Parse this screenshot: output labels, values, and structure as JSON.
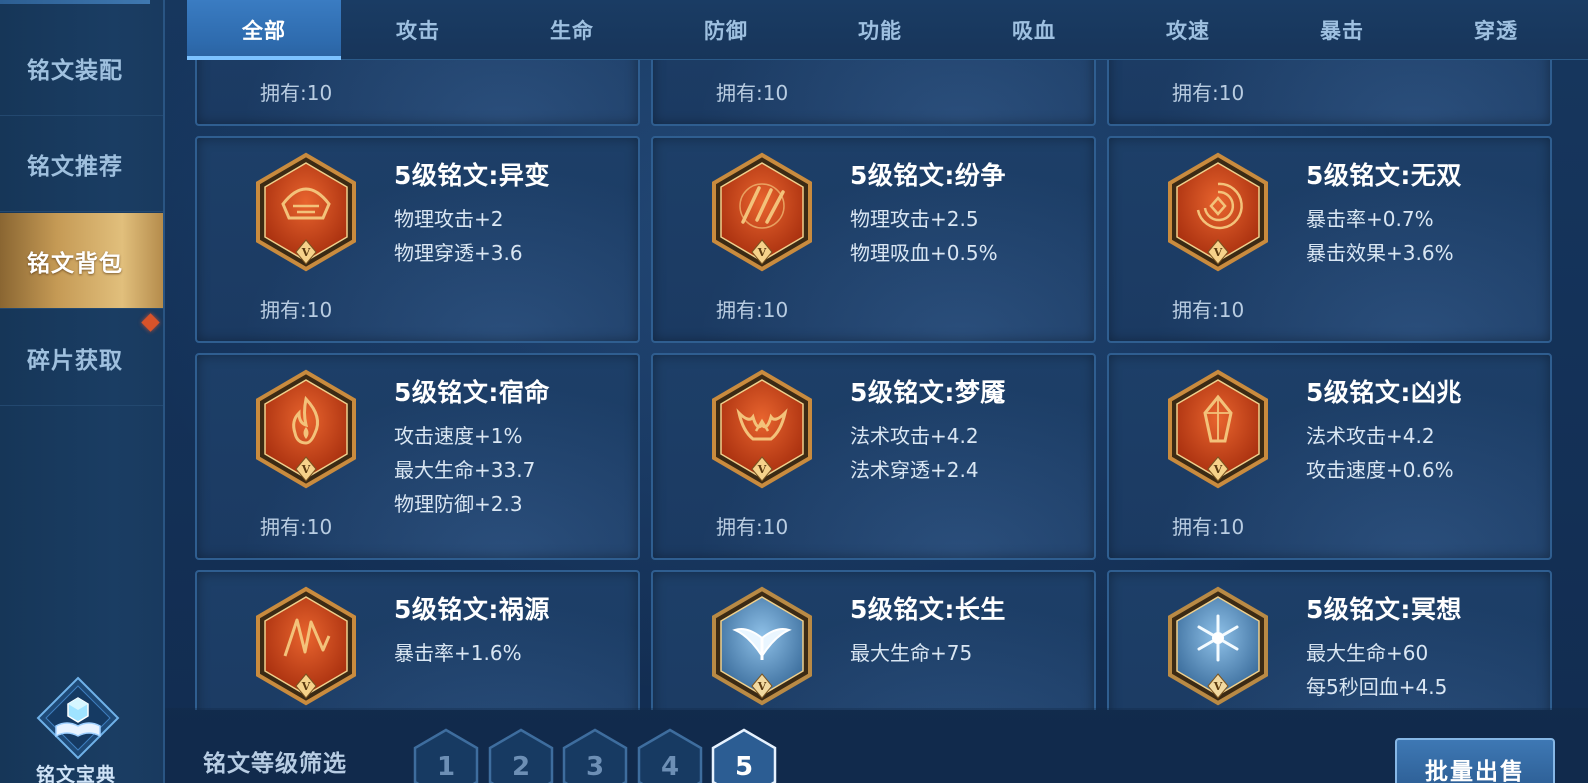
{
  "sidebar": {
    "items": [
      {
        "label": "铭文装配",
        "active": false
      },
      {
        "label": "铭文推荐",
        "active": false
      },
      {
        "label": "铭文背包",
        "active": true
      },
      {
        "label": "碎片获取",
        "active": false
      }
    ],
    "codex_label": "铭文宝典"
  },
  "tabs": [
    {
      "label": "全部",
      "active": true
    },
    {
      "label": "攻击",
      "active": false
    },
    {
      "label": "生命",
      "active": false
    },
    {
      "label": "防御",
      "active": false
    },
    {
      "label": "功能",
      "active": false
    },
    {
      "label": "吸血",
      "active": false
    },
    {
      "label": "攻速",
      "active": false
    },
    {
      "label": "暴击",
      "active": false
    },
    {
      "label": "穿透",
      "active": false
    }
  ],
  "cards": [
    {
      "title": "",
      "stats": [],
      "owned": "拥有:10",
      "color": "none",
      "emblem": "none"
    },
    {
      "title": "",
      "stats": [],
      "owned": "拥有:10",
      "color": "none",
      "emblem": "none"
    },
    {
      "title": "",
      "stats": [],
      "owned": "拥有:10",
      "color": "none",
      "emblem": "none"
    },
    {
      "title": "5级铭文:异变",
      "stats": [
        "物理攻击+2",
        "物理穿透+3.6"
      ],
      "owned": "拥有:10",
      "color": "red",
      "emblem": "helmet-emblem-icon"
    },
    {
      "title": "5级铭文:纷争",
      "stats": [
        "物理攻击+2.5",
        "物理吸血+0.5%"
      ],
      "owned": "拥有:10",
      "color": "red",
      "emblem": "slash-emblem-icon"
    },
    {
      "title": "5级铭文:无双",
      "stats": [
        "暴击率+0.7%",
        "暴击效果+3.6%"
      ],
      "owned": "拥有:10",
      "color": "red",
      "emblem": "vortex-emblem-icon"
    },
    {
      "title": "5级铭文:宿命",
      "stats": [
        "攻击速度+1%",
        "最大生命+33.7",
        "物理防御+2.3"
      ],
      "owned": "拥有:10",
      "color": "red",
      "emblem": "flame-emblem-icon"
    },
    {
      "title": "5级铭文:梦魇",
      "stats": [
        "法术攻击+4.2",
        "法术穿透+2.4"
      ],
      "owned": "拥有:10",
      "color": "red",
      "emblem": "demon-emblem-icon"
    },
    {
      "title": "5级铭文:凶兆",
      "stats": [
        "法术攻击+4.2",
        "攻击速度+0.6%"
      ],
      "owned": "拥有:10",
      "color": "red",
      "emblem": "crystal-emblem-icon"
    },
    {
      "title": "5级铭文:祸源",
      "stats": [
        "暴击率+1.6%"
      ],
      "owned": "",
      "color": "red",
      "emblem": "shards-emblem-icon"
    },
    {
      "title": "5级铭文:长生",
      "stats": [
        "最大生命+75"
      ],
      "owned": "",
      "color": "blue",
      "emblem": "wings-emblem-icon"
    },
    {
      "title": "5级铭文:冥想",
      "stats": [
        "最大生命+60",
        "每5秒回血+4.5"
      ],
      "owned": "",
      "color": "blue",
      "emblem": "snowflake-emblem-icon"
    }
  ],
  "footer": {
    "filter_label": "铭文等级筛选",
    "levels": [
      {
        "label": "1",
        "active": false
      },
      {
        "label": "2",
        "active": false
      },
      {
        "label": "3",
        "active": false
      },
      {
        "label": "4",
        "active": false
      },
      {
        "label": "5",
        "active": true
      }
    ],
    "batch_label": "批量出售"
  },
  "colors": {
    "accent_gold": "#e1bf7c",
    "accent_blue": "#3a7cc2",
    "rune_red": "#d2451e",
    "rune_blue": "#6fa6d6"
  }
}
